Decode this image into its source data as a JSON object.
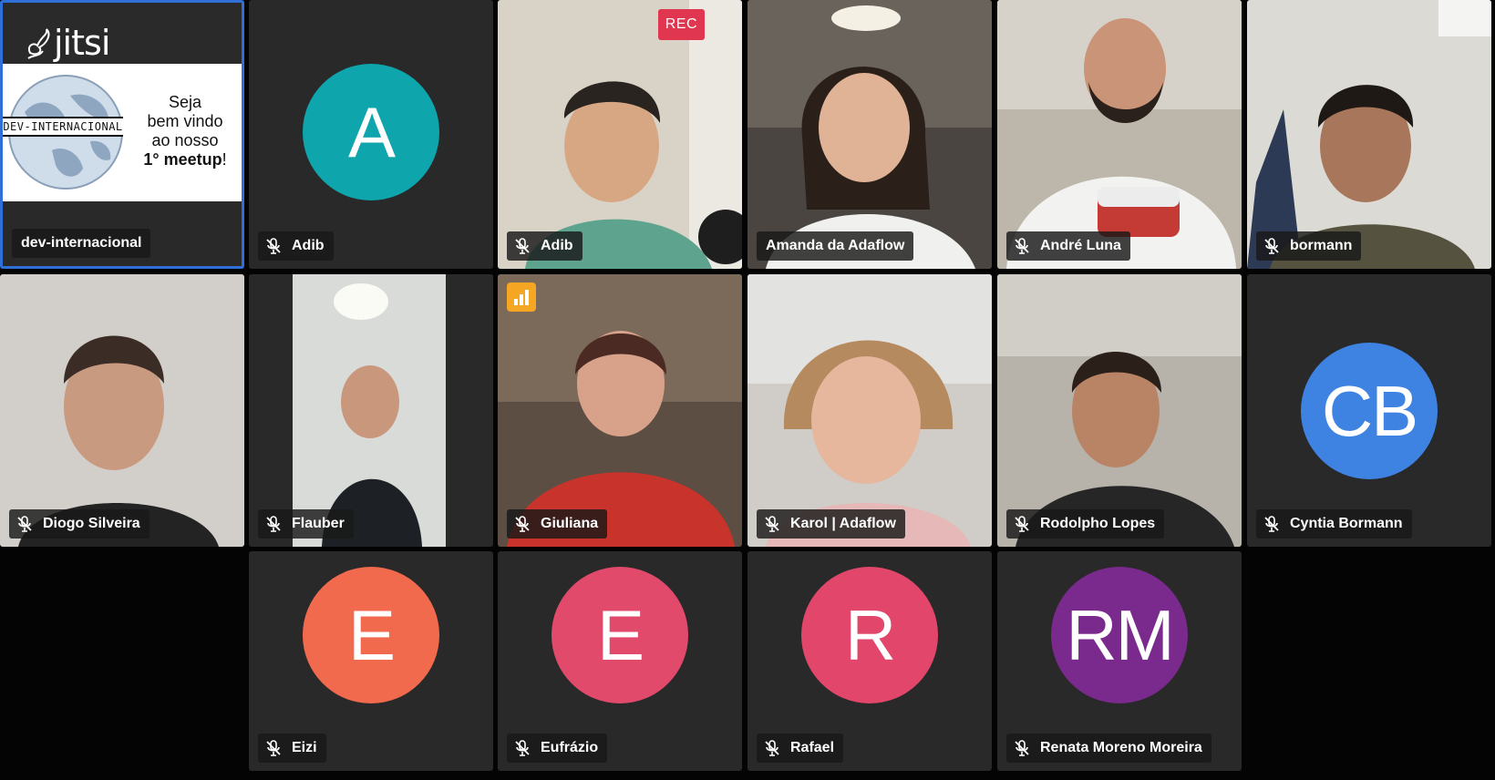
{
  "meeting": {
    "recording_badge": "REC",
    "active_speaker_indicator": "audio-level-icon",
    "colors": {
      "tile_bg": "#292929",
      "selected_border": "#2e6fd8",
      "rec_badge": "#e0364f",
      "speaker_indicator": "#f5a623"
    }
  },
  "shared_content": {
    "brand": "jitsi",
    "slide_banner": "DEV-INTERNACIONAL",
    "slide_lines": [
      "Seja",
      "bem vindo",
      "ao nosso",
      "1° meetup",
      "!"
    ],
    "participant": "dev-internacional"
  },
  "participants": [
    {
      "name": "dev-internacional",
      "muted": false,
      "type": "screen"
    },
    {
      "name": "Adib",
      "muted": true,
      "avatar": "A",
      "avatar_color": "#0ea5ad"
    },
    {
      "name": "Adib",
      "muted": true,
      "type": "video"
    },
    {
      "name": "Amanda da Adaflow",
      "muted": false,
      "type": "video"
    },
    {
      "name": "André Luna",
      "muted": true,
      "type": "video"
    },
    {
      "name": "bormann",
      "muted": true,
      "type": "video"
    },
    {
      "name": "Diogo Silveira",
      "muted": true,
      "type": "video"
    },
    {
      "name": "Flauber",
      "muted": true,
      "type": "video"
    },
    {
      "name": "Giuliana",
      "muted": true,
      "type": "video",
      "speaking": true
    },
    {
      "name": "Karol | Adaflow",
      "muted": true,
      "type": "video"
    },
    {
      "name": "Rodolpho Lopes",
      "muted": true,
      "type": "video"
    },
    {
      "name": "Cyntia Bormann",
      "muted": true,
      "avatar": "CB",
      "avatar_color": "#3f83e2"
    },
    {
      "name": "Eizi",
      "muted": true,
      "avatar": "E",
      "avatar_color": "#f26a4d"
    },
    {
      "name": "Eufrázio",
      "muted": true,
      "avatar": "E",
      "avatar_color": "#e24a6c"
    },
    {
      "name": "Rafael",
      "muted": true,
      "avatar": "R",
      "avatar_color": "#e2476b"
    },
    {
      "name": "Renata Moreno Moreira",
      "muted": true,
      "avatar": "RM",
      "avatar_color": "#7a2a8c"
    }
  ]
}
